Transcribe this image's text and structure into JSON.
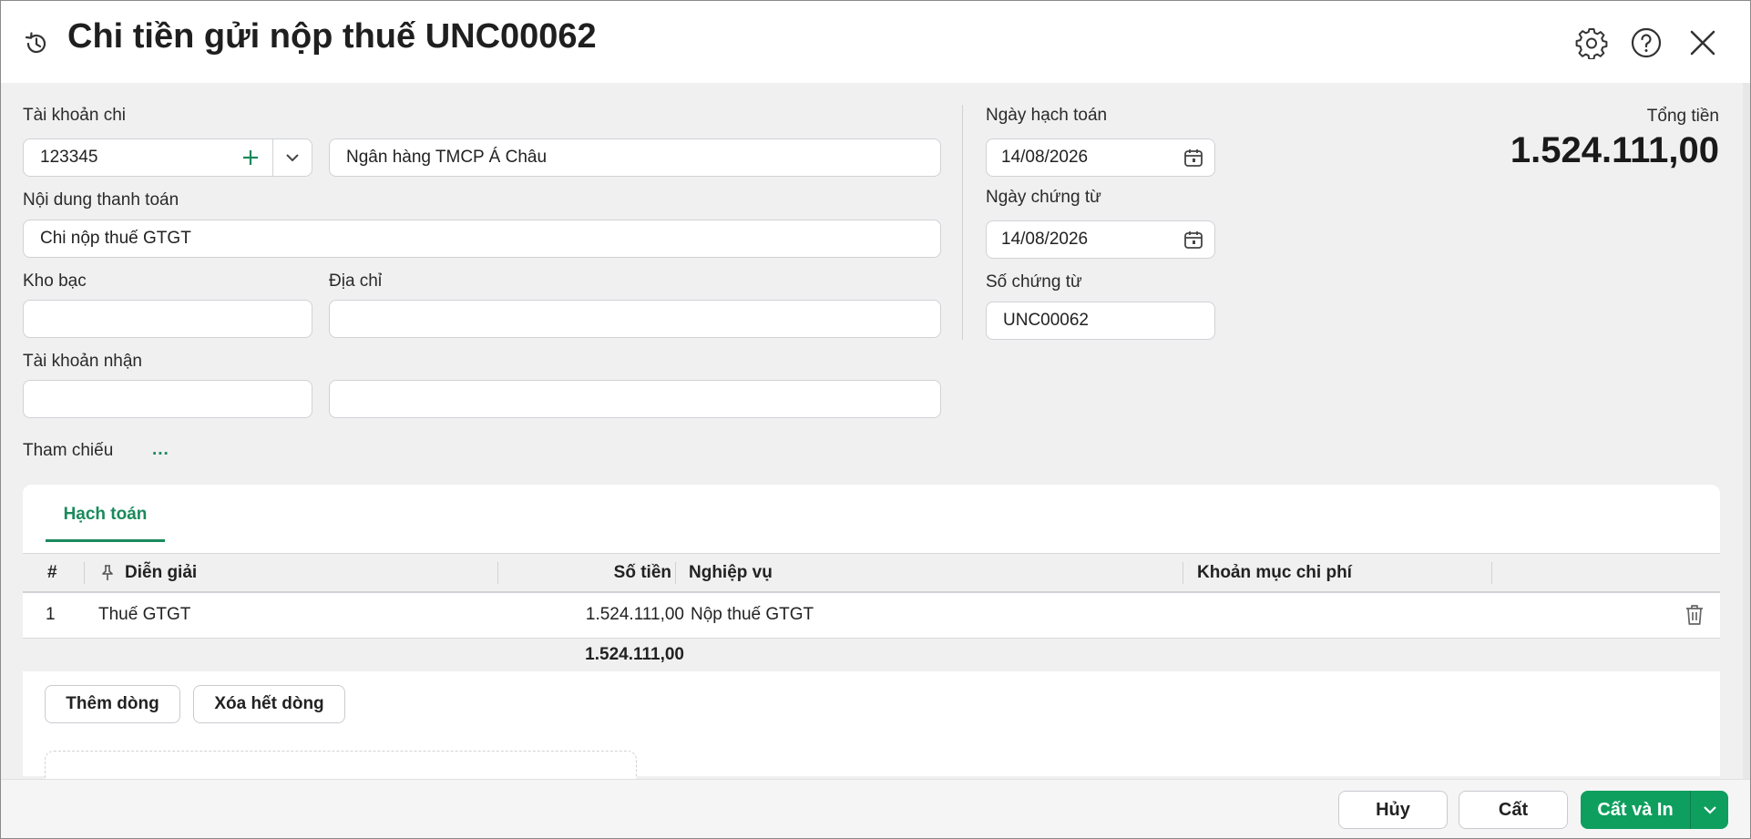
{
  "header": {
    "title": "Chi tiền gửi nộp thuế UNC00062",
    "icons": [
      "history-icon",
      "gear-icon",
      "help-icon",
      "close-icon"
    ]
  },
  "form": {
    "tai_khoan_chi": {
      "label": "Tài khoản chi",
      "value": "123345",
      "bank_name": "Ngân hàng TMCP Á Châu"
    },
    "noi_dung": {
      "label": "Nội dung thanh toán",
      "value": "Chi nộp thuế GTGT"
    },
    "kho_bac": {
      "label": "Kho bạc",
      "value": ""
    },
    "dia_chi": {
      "label": "Địa chỉ",
      "value": ""
    },
    "tai_khoan_nhan": {
      "label": "Tài khoản nhận",
      "value": "",
      "name_value": ""
    },
    "tham_chieu": {
      "label": "Tham chiếu",
      "more": "..."
    },
    "ngay_hach_toan": {
      "label": "Ngày hạch toán",
      "value": "14/08/2026"
    },
    "ngay_chung_tu": {
      "label": "Ngày chứng từ",
      "value": "14/08/2026"
    },
    "so_chung_tu": {
      "label": "Số chứng từ",
      "value": "UNC00062"
    },
    "tong_tien": {
      "label": "Tổng tiền",
      "value": "1.524.111,00"
    }
  },
  "tabs": [
    {
      "label": "Hạch toán",
      "active": true
    }
  ],
  "table": {
    "columns": [
      "#",
      "Diễn giải",
      "Số tiền",
      "Nghiệp vụ",
      "Khoản mục chi phí"
    ],
    "rows": [
      {
        "no": "1",
        "dien_giai": "Thuế GTGT",
        "so_tien": "1.524.111,00",
        "nghiep_vu": "Nộp thuế GTGT",
        "khoan_muc": ""
      }
    ],
    "total": "1.524.111,00"
  },
  "table_buttons": {
    "add_row": "Thêm dòng",
    "clear_rows": "Xóa hết dòng"
  },
  "footer": {
    "cancel": "Hủy",
    "save": "Cất",
    "save_print": "Cất và In"
  },
  "colors": {
    "accent": "#0e9f5e",
    "accent_text": "#1a8a5c",
    "background": "#f0f0f1"
  }
}
